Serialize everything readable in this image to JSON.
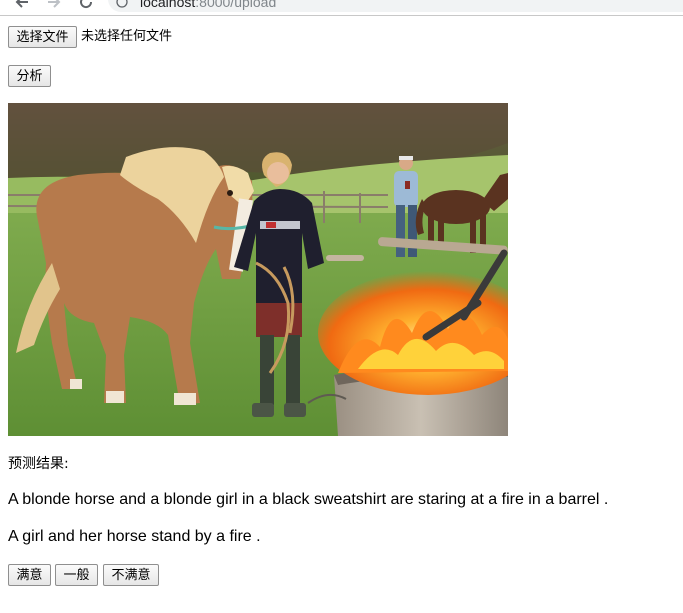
{
  "browser": {
    "url_host": "localhost",
    "url_path": ":8000/upload"
  },
  "upload": {
    "choose_file_label": "选择文件",
    "no_file_text": "未选择任何文件",
    "analyze_label": "分析"
  },
  "image": {
    "alt": "A blonde horse and a girl in a black sweatshirt by a fire in a barrel, with a man and a brown horse in a field behind"
  },
  "result": {
    "label": "预测结果:",
    "captions": [
      "A blonde horse and a blonde girl in a black sweatshirt are staring at a fire in a barrel .",
      "A girl and her horse stand by a fire ."
    ]
  },
  "feedback": {
    "satisfied_label": "满意",
    "neutral_label": "一般",
    "unsatisfied_label": "不满意"
  }
}
